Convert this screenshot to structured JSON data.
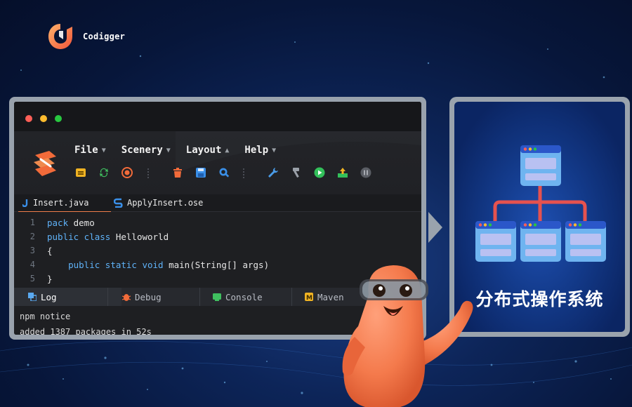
{
  "brand": {
    "name": "Codigger"
  },
  "ide": {
    "menu": [
      {
        "label": "File",
        "chevron": "chevron-down"
      },
      {
        "label": "Scenery",
        "chevron": "chevron-down"
      },
      {
        "label": "Layout",
        "chevron": "chevron-up"
      },
      {
        "label": "Help",
        "chevron": "chevron-down"
      }
    ],
    "toolbar_icons": [
      "layers-icon",
      "refresh-icon",
      "record-icon",
      "delete-icon",
      "save-icon",
      "search-icon",
      "wrench-icon",
      "hammer-icon",
      "run-icon",
      "deploy-icon",
      "pause-icon"
    ],
    "tabs": [
      {
        "label": "Insert.java",
        "icon": "java-icon",
        "active": true
      },
      {
        "label": "ApplyInsert.ose",
        "icon": "ose-icon",
        "active": false
      }
    ],
    "code": [
      {
        "n": "1",
        "kw": "pack",
        "rest": " demo",
        "indent": ""
      },
      {
        "n": "2",
        "kw": "public class",
        "rest": " Helloworld",
        "indent": ""
      },
      {
        "n": "3",
        "kw": "",
        "rest": "{",
        "indent": ""
      },
      {
        "n": "4",
        "kw": "public static void",
        "rest": " main(String[] args)",
        "indent": "    "
      },
      {
        "n": "5",
        "kw": "",
        "rest": "}",
        "indent": ""
      }
    ],
    "panel_tabs": [
      {
        "label": "Log",
        "icon": "log-icon",
        "active": true
      },
      {
        "label": "Debug",
        "icon": "bug-icon",
        "active": false
      },
      {
        "label": "Console",
        "icon": "console-icon",
        "active": false
      },
      {
        "label": "Maven",
        "icon": "maven-icon",
        "active": false
      }
    ],
    "log_lines": [
      "npm notice",
      "added 1387 packages in 52s"
    ]
  },
  "card": {
    "title": "分布式操作系统"
  },
  "colors": {
    "accent": "#ef7d4b",
    "keyword": "#5fb2f8",
    "node_blue": "#6fb4f0",
    "connector": "#e5524f"
  }
}
